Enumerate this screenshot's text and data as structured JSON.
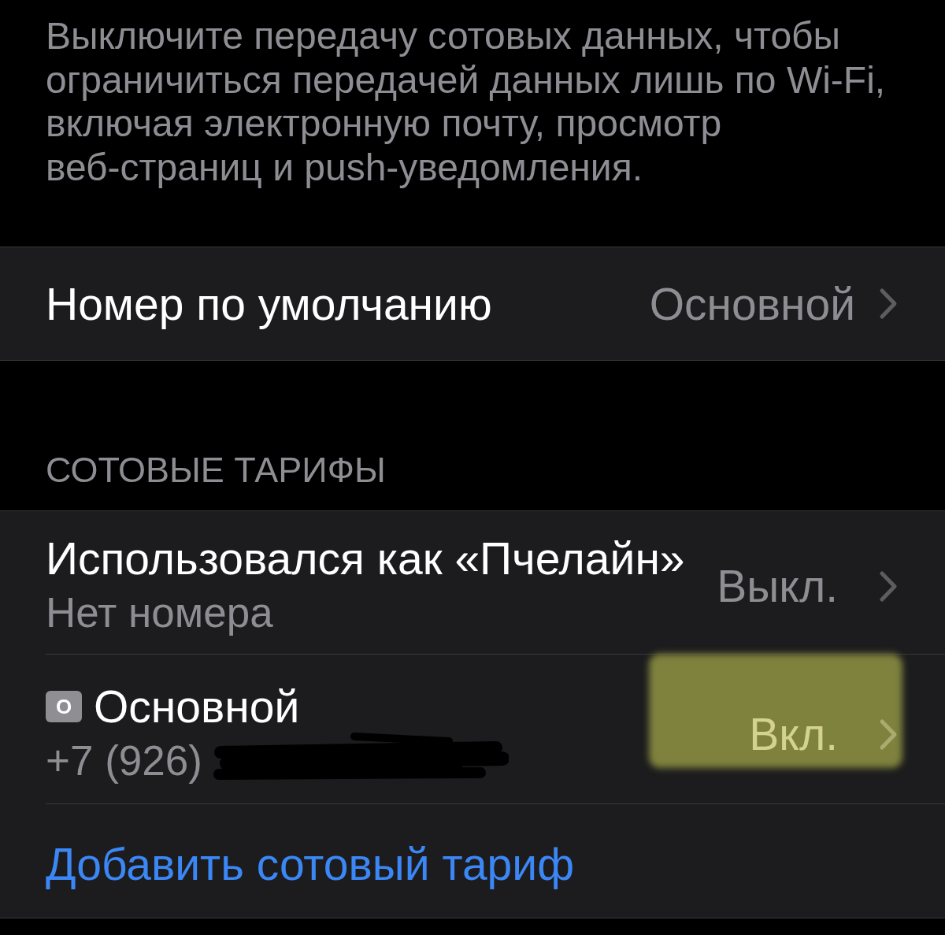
{
  "footer_note": "Выключите передачу сотовых данных, чтобы ограничиться передачей данных лишь по Wi-Fi, включая электронную почту, просмотр веб-страниц и push-уведомления.",
  "default_number": {
    "label": "Номер по умолчанию",
    "value": "Основной"
  },
  "plans_section": {
    "header": "СОТОВЫЕ ТАРИФЫ",
    "plans": [
      {
        "title": "Использовался как «Пчелайн»",
        "subtitle": "Нет номера",
        "value": "Выкл.",
        "highlighted": false,
        "redacted": false
      },
      {
        "badge": "О",
        "title": "Основной",
        "subtitle": "+7 (926)",
        "value": "Вкл.",
        "highlighted": true,
        "redacted": true
      }
    ],
    "add_link": "Добавить сотовый тариф"
  }
}
